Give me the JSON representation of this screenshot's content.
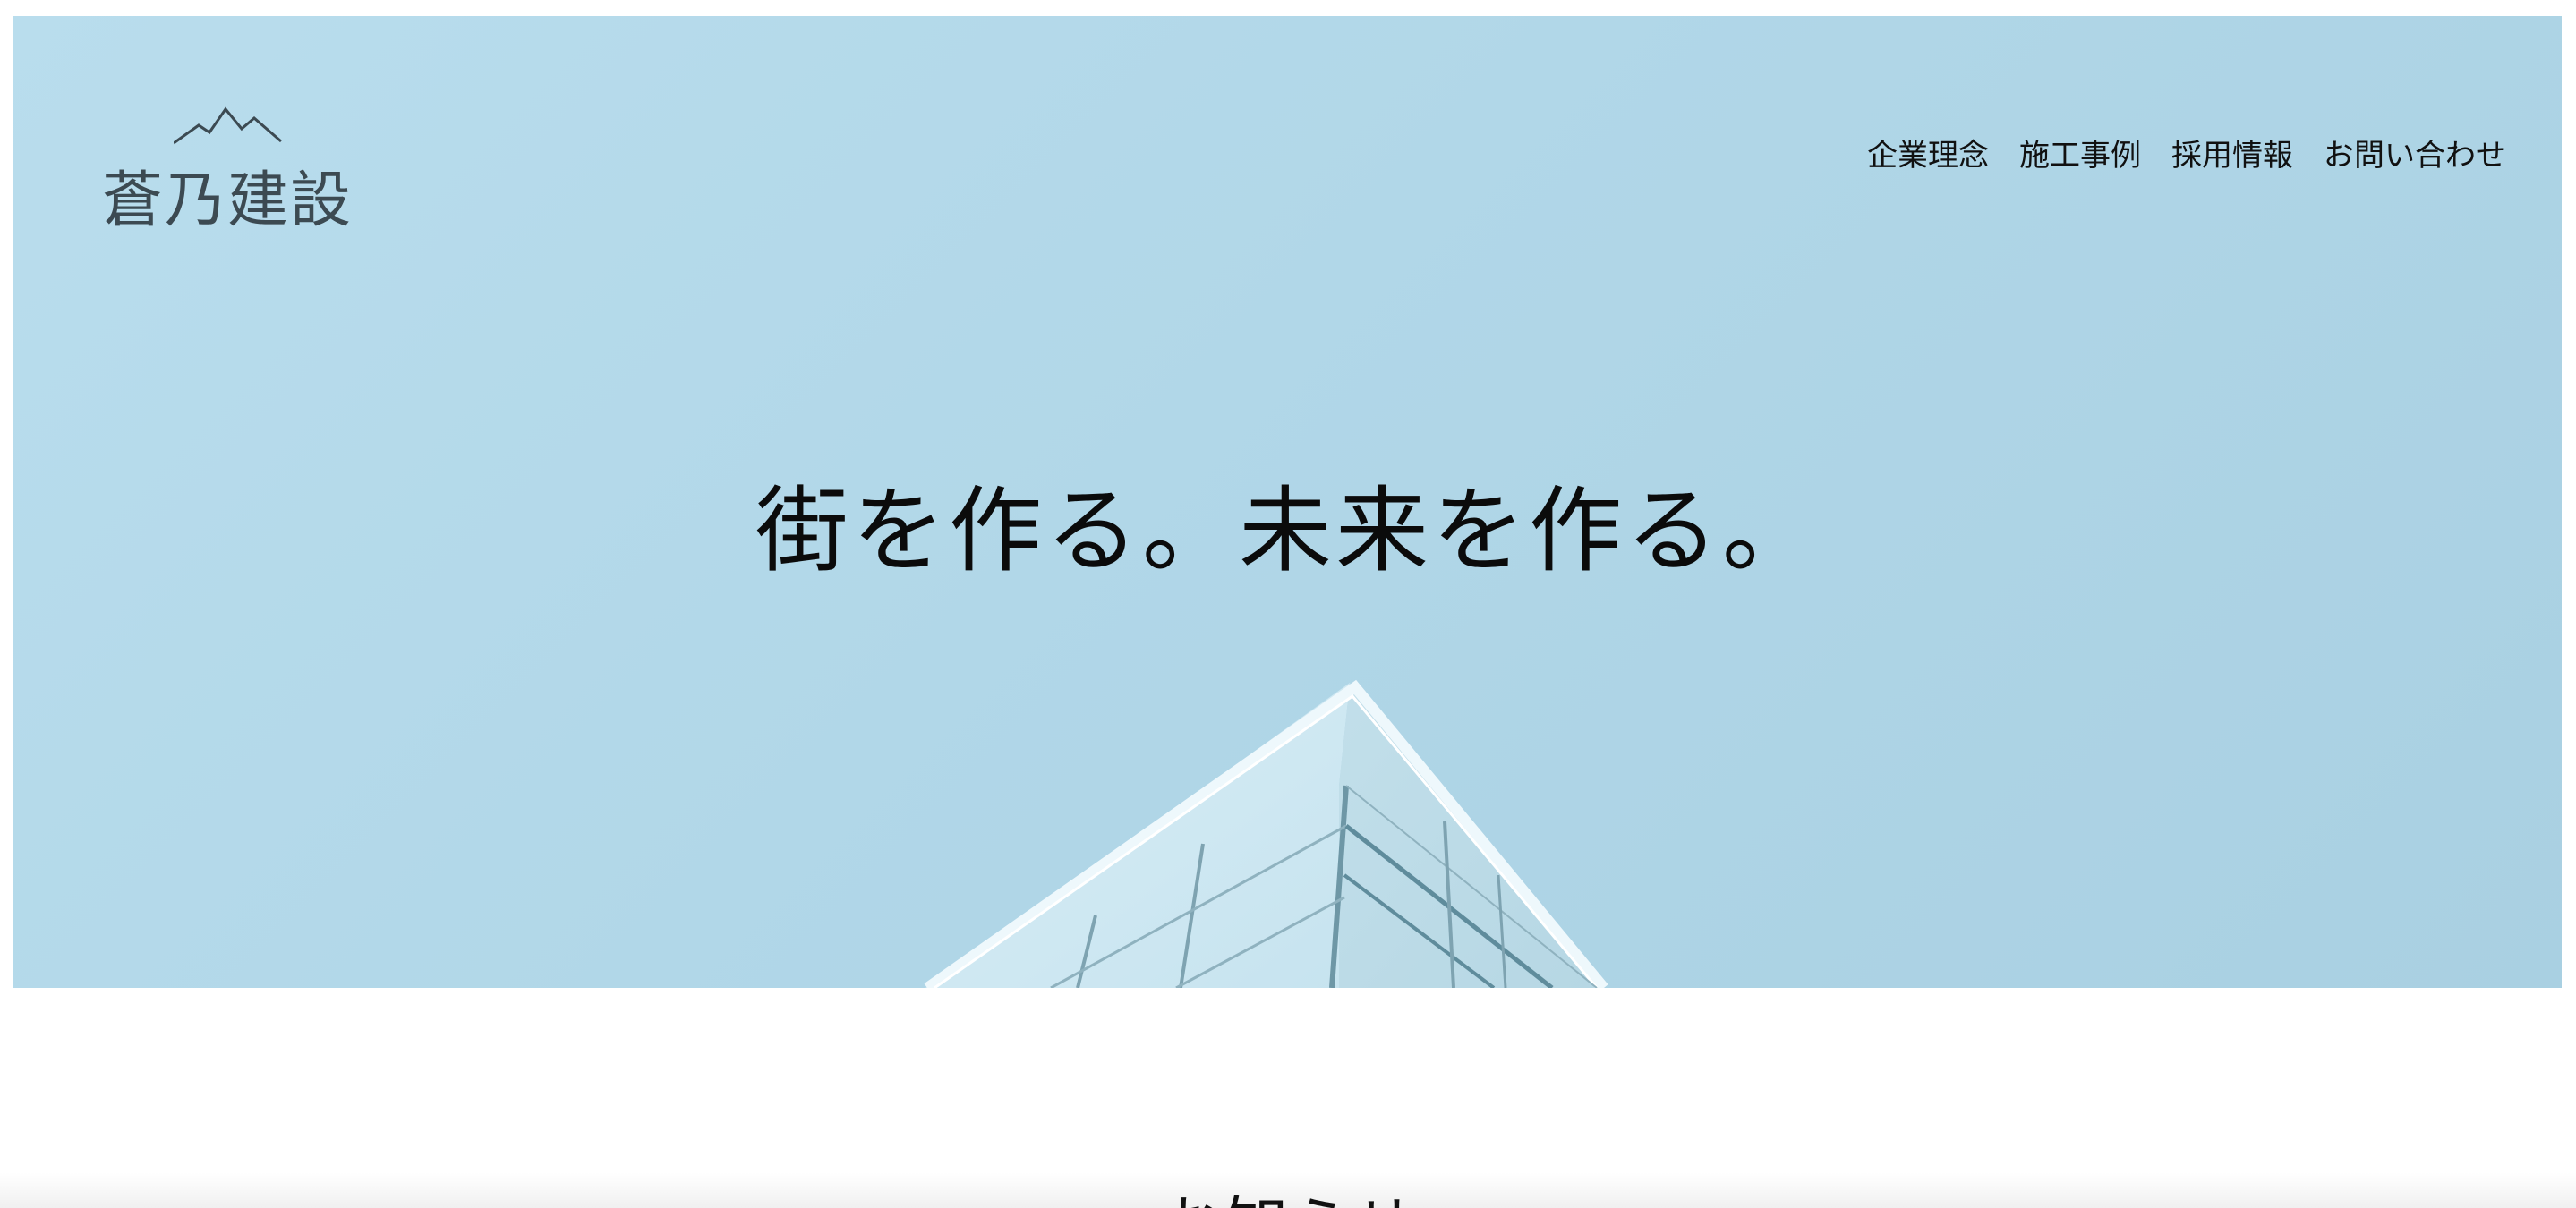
{
  "brand": {
    "name": "蒼乃建設",
    "icon": "mountain-logo-icon"
  },
  "nav": {
    "items": [
      {
        "label": "企業理念"
      },
      {
        "label": "施工事例"
      },
      {
        "label": "採用情報"
      },
      {
        "label": "お問い合わせ"
      }
    ]
  },
  "hero": {
    "tagline": "街を作る。未来を作る。",
    "background_color": "#b1d7e8"
  },
  "news": {
    "title": "お知らせ"
  }
}
